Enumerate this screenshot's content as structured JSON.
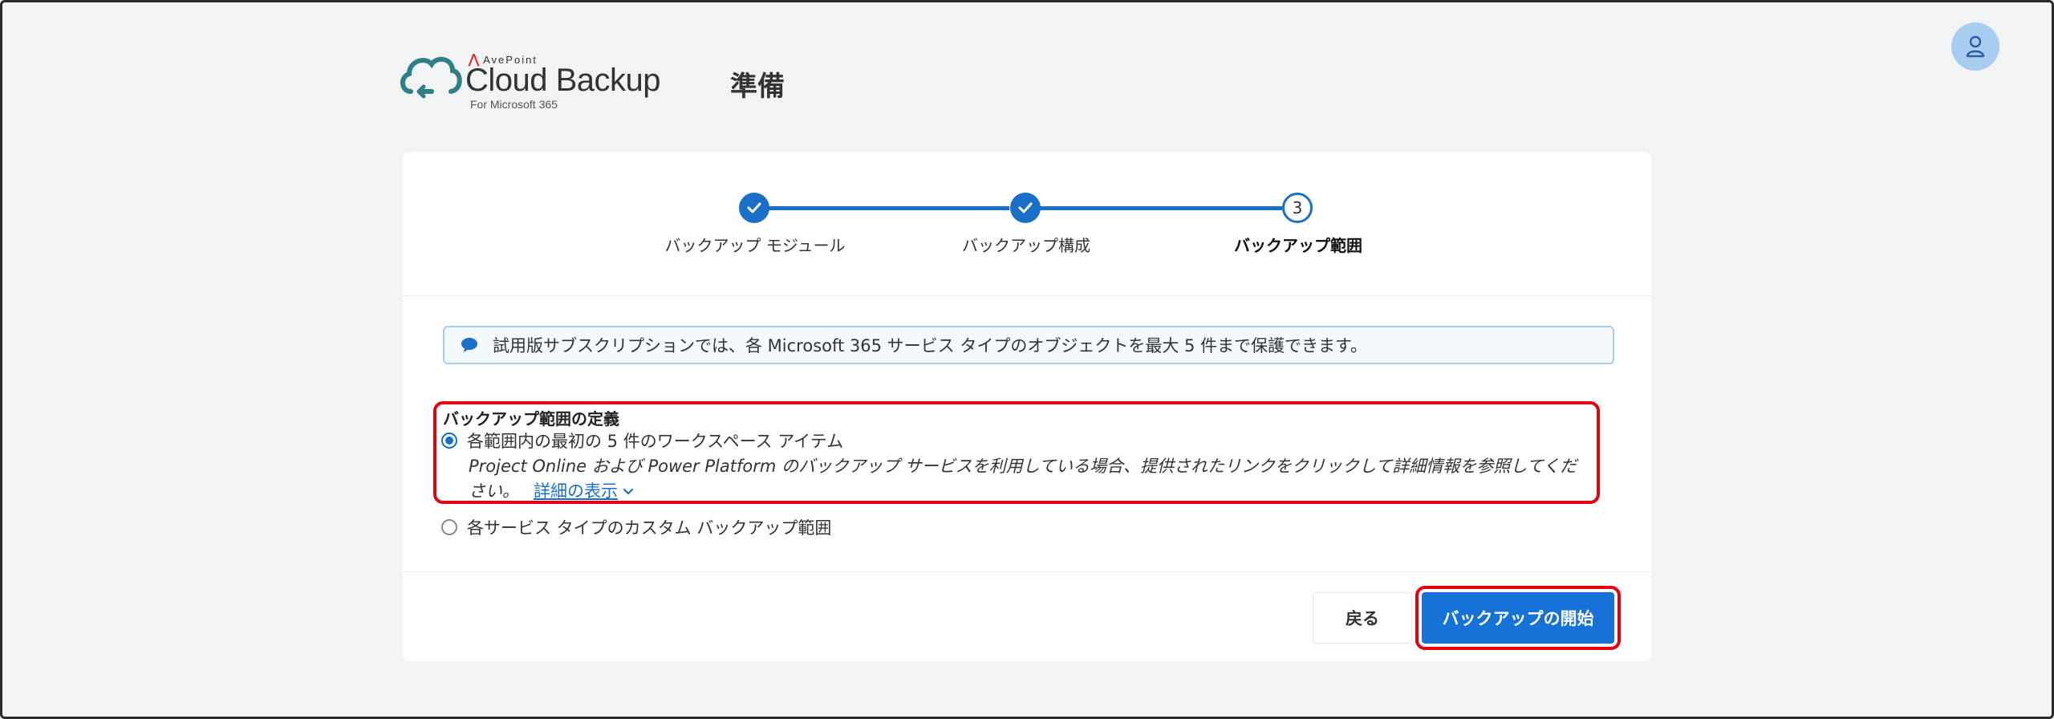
{
  "header": {
    "brand_top": "AvePoint",
    "brand_main": "Cloud Backup",
    "brand_sub": "For Microsoft 365",
    "page_title": "準備",
    "avatar_icon": "user-icon"
  },
  "stepper": {
    "steps": [
      {
        "label": "バックアップ モジュール",
        "state": "done"
      },
      {
        "label": "バックアップ構成",
        "state": "done"
      },
      {
        "label": "バックアップ範囲",
        "number": "3",
        "state": "current"
      }
    ]
  },
  "notice": {
    "icon": "chat-bubble-icon",
    "text": "試用版サブスクリプションでは、各 Microsoft 365 サービス タイプのオブジェクトを最大 5 件まで保護できます。"
  },
  "scope": {
    "title": "バックアップ範囲の定義",
    "options": [
      {
        "label": "各範囲内の最初の 5 件のワークスペース アイテム",
        "selected": true
      },
      {
        "label": "各サービス タイプのカスタム バックアップ範囲",
        "selected": false
      }
    ],
    "description": "Project Online および Power Platform のバックアップ サービスを利用している場合、提供されたリンクをクリックして詳細情報を参照してください。",
    "details_link": "詳細の表示"
  },
  "footer": {
    "back_label": "戻る",
    "start_label": "バックアップの開始"
  },
  "colors": {
    "accent": "#1a6fc9",
    "highlight": "#e3000f",
    "logo_teal": "#2f7f86"
  }
}
